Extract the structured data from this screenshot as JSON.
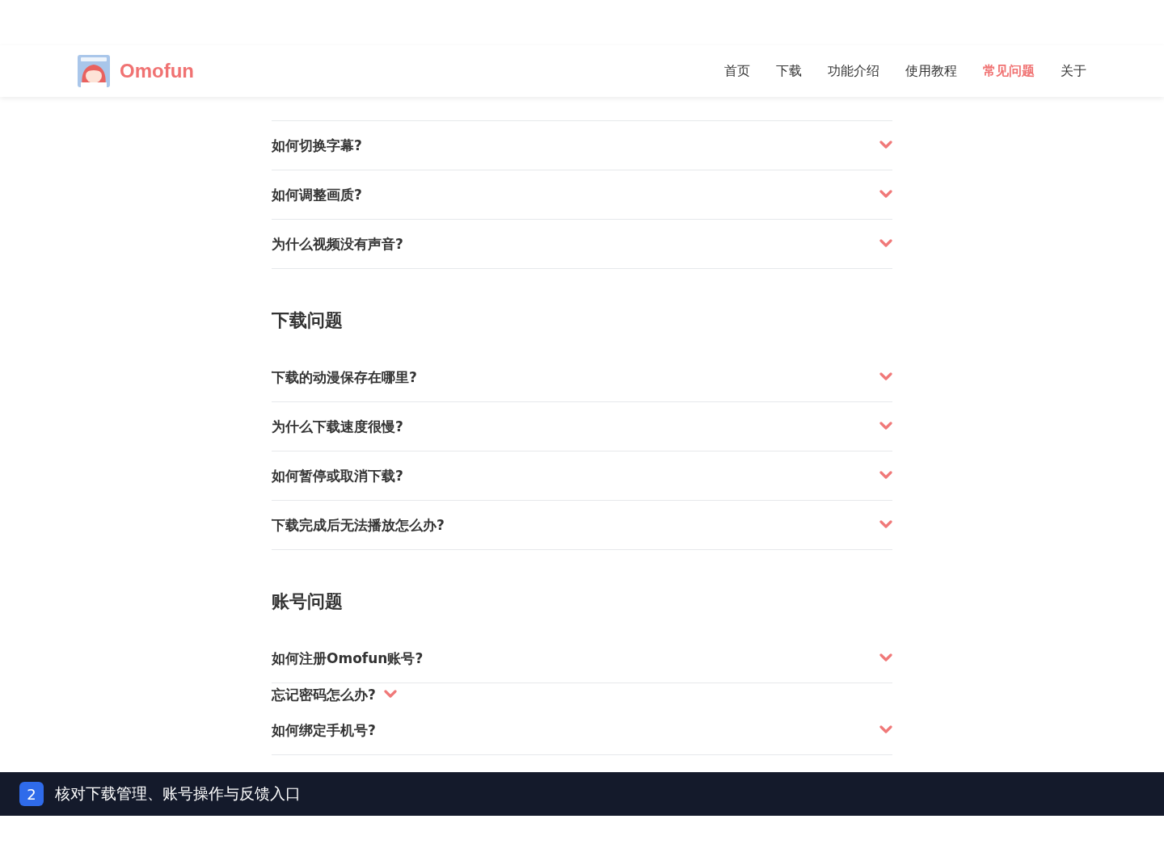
{
  "header": {
    "brand": "Omofun",
    "nav": [
      {
        "label": "首页",
        "selected": false
      },
      {
        "label": "下载",
        "selected": false
      },
      {
        "label": "功能介绍",
        "selected": false
      },
      {
        "label": "使用教程",
        "selected": false
      },
      {
        "label": "常见问题",
        "selected": true
      },
      {
        "label": "关于",
        "selected": false
      }
    ]
  },
  "sections": [
    {
      "items": [
        {
          "question": "如何切换字幕?",
          "kind": "row"
        },
        {
          "question": "如何调整画质?",
          "kind": "row"
        },
        {
          "question": "为什么视频没有声音?",
          "kind": "row"
        }
      ]
    },
    {
      "title": "下载问题",
      "items": [
        {
          "question": "下载的动漫保存在哪里?",
          "kind": "row"
        },
        {
          "question": "为什么下载速度很慢?",
          "kind": "row"
        },
        {
          "question": "如何暂停或取消下载?",
          "kind": "row"
        },
        {
          "question": "下载完成后无法播放怎么办?",
          "kind": "row"
        }
      ]
    },
    {
      "title": "账号问题",
      "items": [
        {
          "question": "如何注册Omofun账号?",
          "kind": "row"
        },
        {
          "question": "忘记密码怎么办?",
          "kind": "inline"
        },
        {
          "question": "如何绑定手机号?",
          "kind": "row"
        }
      ]
    }
  ],
  "caption": {
    "step": "2",
    "text": "核对下载管理、账号操作与反馈入口"
  }
}
